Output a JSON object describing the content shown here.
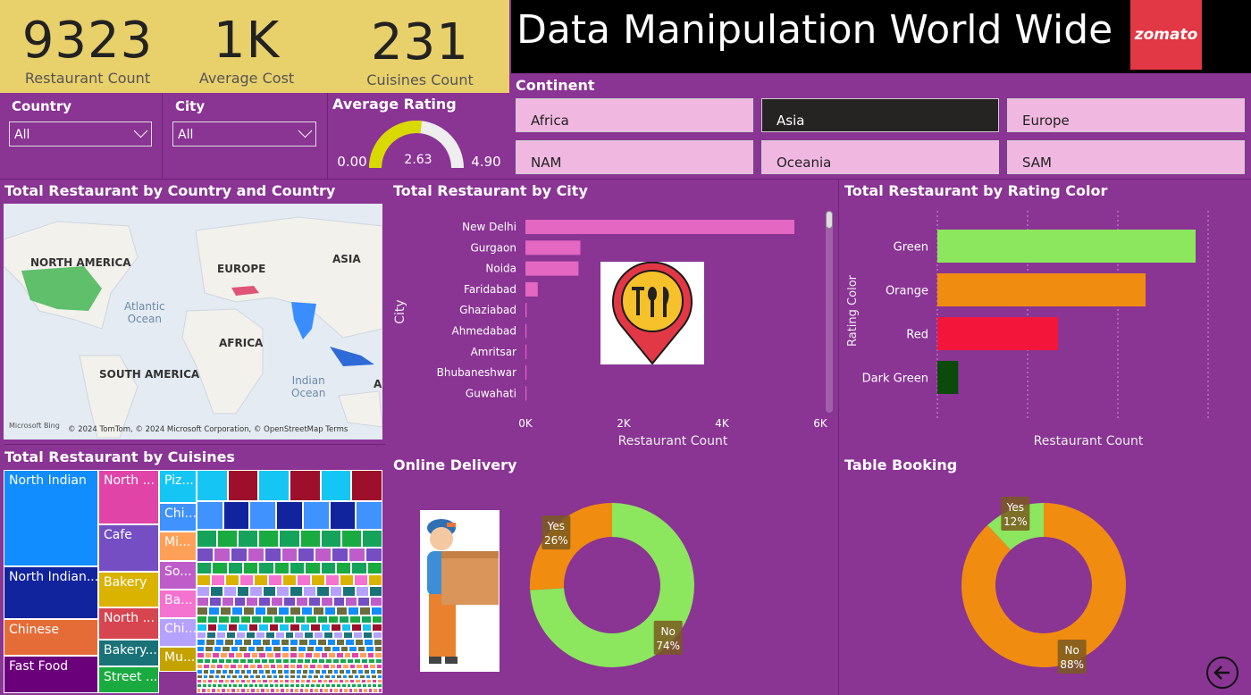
{
  "kpis": [
    {
      "value": "9323",
      "label": "Restaurant Count"
    },
    {
      "value": "1K",
      "label": "Average Cost"
    },
    {
      "value": "231",
      "label": "Cuisines Count"
    }
  ],
  "title": "Data Manipulation World Wide",
  "logo_text": "zomato",
  "filters": {
    "country": {
      "label": "Country",
      "value": "All"
    },
    "city": {
      "label": "City",
      "value": "All"
    }
  },
  "gauge": {
    "title": "Average Rating",
    "min": "0.00",
    "max": "4.90",
    "value": "2.63",
    "value_num": 2.63,
    "max_num": 4.9
  },
  "continent": {
    "label": "Continent",
    "options": [
      "Africa",
      "Asia",
      "Europe",
      "NAM",
      "Oceania",
      "SAM"
    ],
    "selected": "Asia"
  },
  "map": {
    "title": "Total Restaurant by Country and Country",
    "labels": [
      "NORTH AMERICA",
      "EUROPE",
      "ASIA",
      "AFRICA",
      "SOUTH AMERICA",
      "A"
    ],
    "oceans": [
      "Atlantic\nOcean",
      "Indian\nOcean"
    ],
    "attribution": "© 2024 TomTom, © 2024 Microsoft Corporation, © OpenStreetMap  Terms",
    "provider": "Microsoft Bing"
  },
  "city_chart_title": "Total Restaurant by City",
  "rating_chart_title": "Total Restaurant by Rating Color",
  "cuisines_title": "Total Restaurant by Cuisines",
  "cuisines": [
    {
      "label": "North Indian",
      "color": "#118DFF"
    },
    {
      "label": "North Indian...",
      "color": "#12239E"
    },
    {
      "label": "Chinese",
      "color": "#E66C37"
    },
    {
      "label": "Fast Food",
      "color": "#6B007B"
    },
    {
      "label": "North ...",
      "color": "#E044A7"
    },
    {
      "label": "Cafe",
      "color": "#744EC2"
    },
    {
      "label": "Bakery",
      "color": "#D9B300"
    },
    {
      "label": "North ...",
      "color": "#D64550"
    },
    {
      "label": "Bakery...",
      "color": "#197278"
    },
    {
      "label": "Street ...",
      "color": "#1AAB40"
    },
    {
      "label": "Piz...",
      "color": "#15C6F4"
    },
    {
      "label": "Chi...",
      "color": "#4092FF"
    },
    {
      "label": "Mi...",
      "color": "#FFA058"
    },
    {
      "label": "So...",
      "color": "#BE5DC9"
    },
    {
      "label": "Ba...",
      "color": "#F472D0"
    },
    {
      "label": "Chi...",
      "color": "#B5A1FF"
    },
    {
      "label": "Mu...",
      "color": "#C4A200"
    }
  ],
  "online_delivery": {
    "title": "Online Delivery",
    "yes_label": "Yes\n26%",
    "no_label": "No\n74%"
  },
  "table_booking": {
    "title": "Table Booking",
    "yes_label": "Yes\n12%",
    "no_label": "No\n88%"
  },
  "chart_data": [
    {
      "type": "bar",
      "orientation": "horizontal",
      "title": "Total Restaurant by City",
      "xlabel": "Restaurant Count",
      "ylabel": "City",
      "categories": [
        "New Delhi",
        "Gurgaon",
        "Noida",
        "Faridabad",
        "Ghaziabad",
        "Ahmedabad",
        "Amritsar",
        "Bhubaneshwar",
        "Guwahati"
      ],
      "values": [
        5473,
        1118,
        1080,
        251,
        25,
        21,
        21,
        21,
        21
      ],
      "xlim": [
        0,
        6000
      ],
      "xticks": [
        "0K",
        "2K",
        "4K",
        "6K"
      ],
      "color": "#E467C2"
    },
    {
      "type": "bar",
      "orientation": "horizontal",
      "title": "Total Restaurant by Rating Color",
      "xlabel": "Restaurant Count",
      "ylabel": "Rating Color",
      "categories": [
        "Green",
        "Orange",
        "Red",
        "Dark Green"
      ],
      "values": [
        3100,
        2500,
        1450,
        250
      ],
      "xlim": [
        0,
        3250
      ],
      "colors": [
        "#8CE65E",
        "#F08C10",
        "#F4163A",
        "#0A4A0A"
      ]
    },
    {
      "type": "pie",
      "title": "Online Delivery",
      "labels": [
        "Yes",
        "No"
      ],
      "values": [
        26,
        74
      ],
      "colors": [
        "#F08C10",
        "#8CE65E"
      ]
    },
    {
      "type": "pie",
      "title": "Table Booking",
      "labels": [
        "Yes",
        "No"
      ],
      "values": [
        12,
        88
      ],
      "colors": [
        "#8CE65E",
        "#F08C10"
      ]
    }
  ]
}
